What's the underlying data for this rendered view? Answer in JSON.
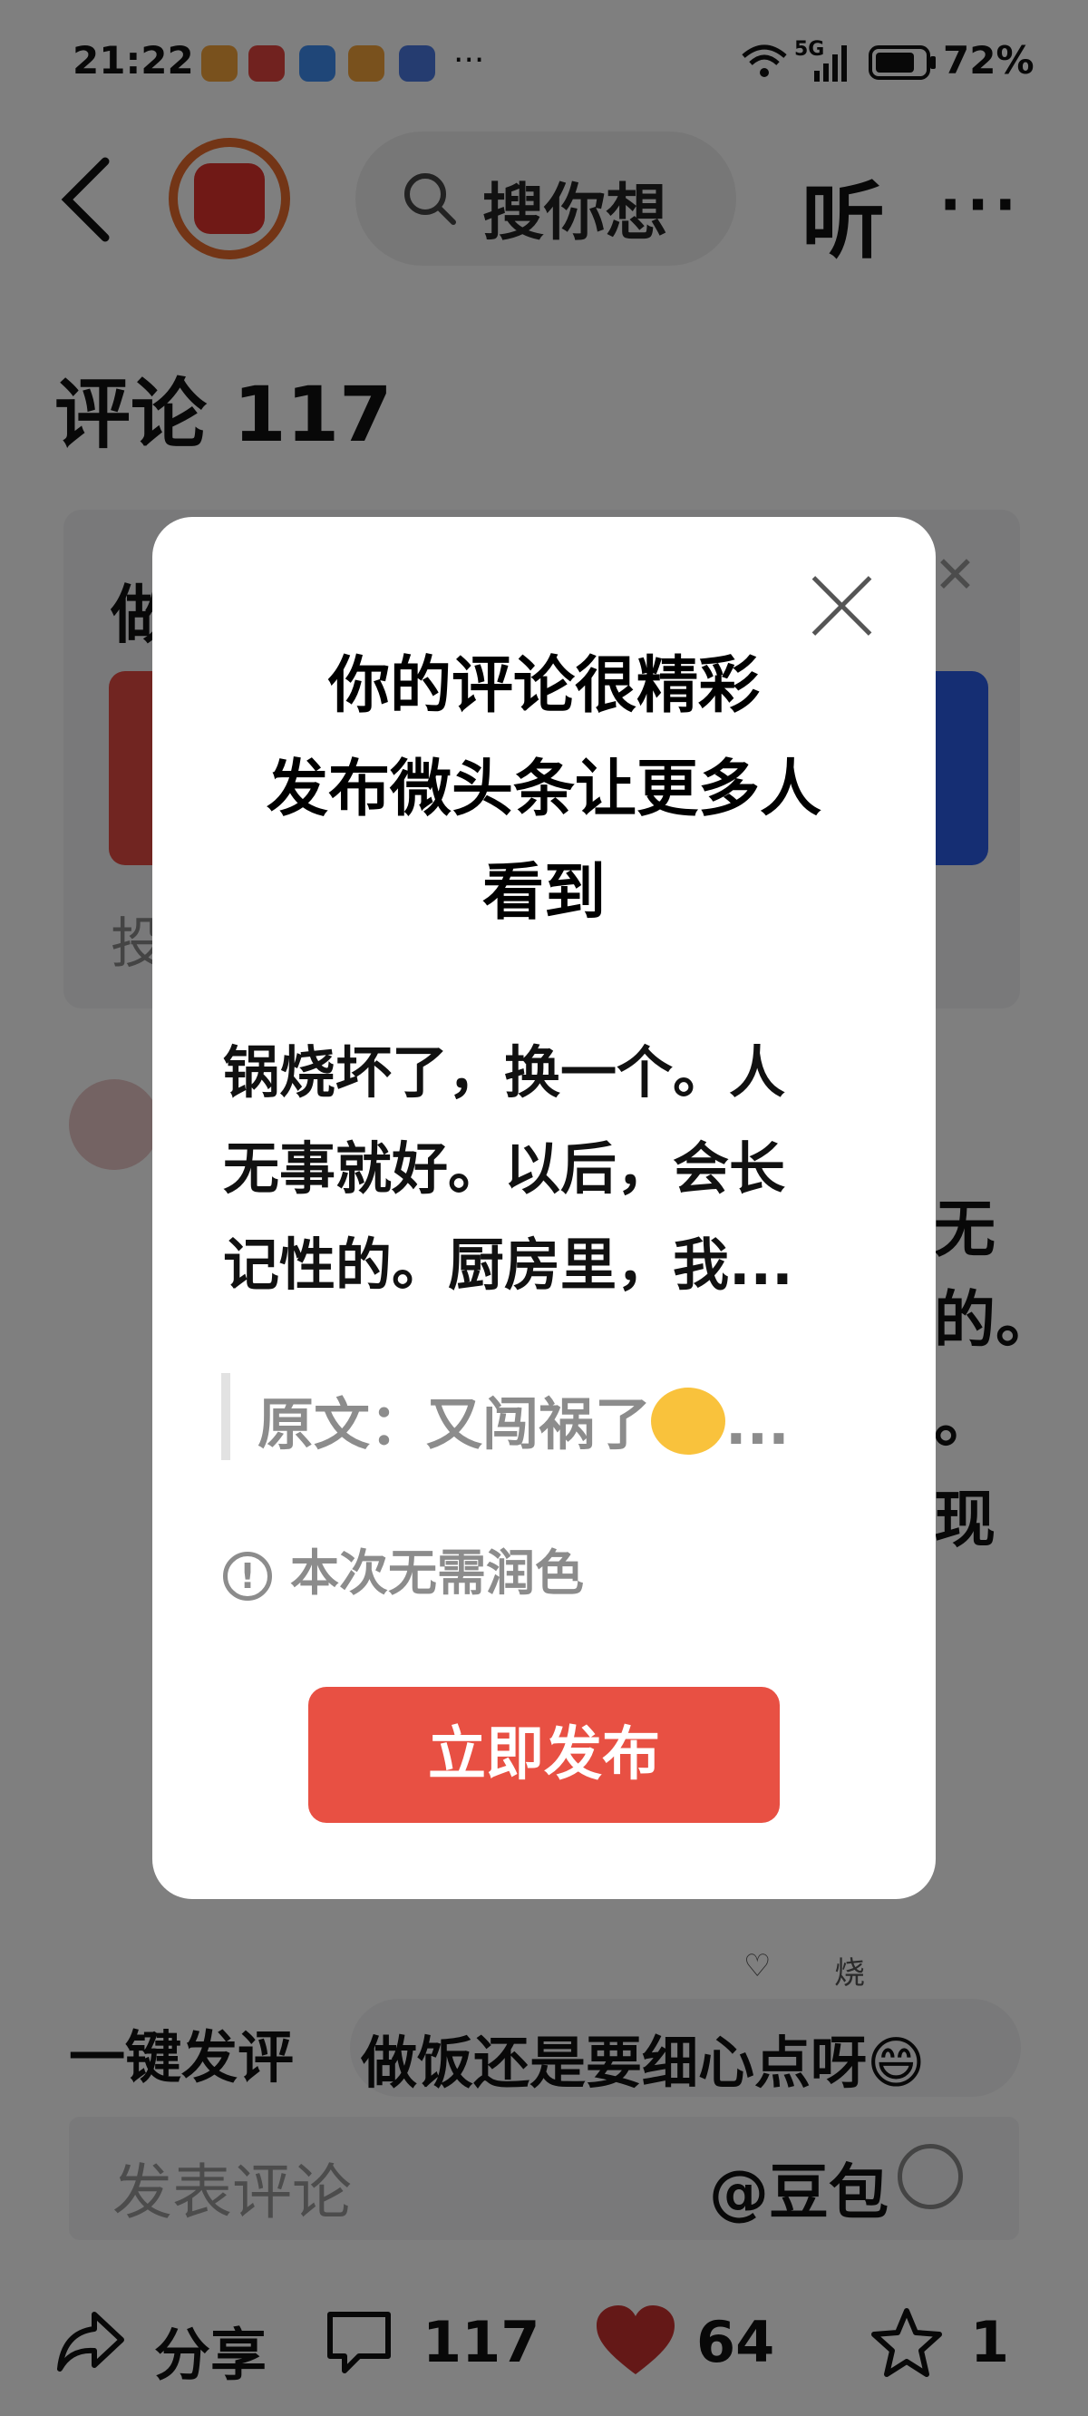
{
  "status_bar": {
    "time": "21:22",
    "signal": "5G",
    "battery": "72%"
  },
  "header": {
    "search_placeholder": "搜你想",
    "listen_label": "听",
    "more_label": "···"
  },
  "comments": {
    "title": "评论 117"
  },
  "background": {
    "card_title_partial": "做",
    "card_footer_partial": "投",
    "side_texts": [
      "无",
      "的。",
      "。",
      "现"
    ],
    "actions_partial": "烧"
  },
  "quick_comment": {
    "label": "一键发评",
    "suggestion": "做饭还是要细心点呀😄"
  },
  "comment_input": {
    "placeholder": "发表评论",
    "mention": "@豆包"
  },
  "bottom_bar": {
    "share_label": "分享",
    "comment_count": "117",
    "like_count": "64",
    "favorite_count": "1"
  },
  "dialog": {
    "title_lines": [
      "你的评论很精彩",
      "发布微头条让更多人",
      "看到"
    ],
    "body_lines": [
      "锅烧坏了，换一个。人",
      "无事就好。以后，会长",
      "记性的。厨房里，我..."
    ],
    "quote_label": "原文：又闯祸了",
    "quote_suffix": "...",
    "info_text": "本次无需润色",
    "publish_label": "立即发布"
  },
  "colors": {
    "accent": "#e85043",
    "overlay": "rgba(0,0,0,0.5)"
  }
}
